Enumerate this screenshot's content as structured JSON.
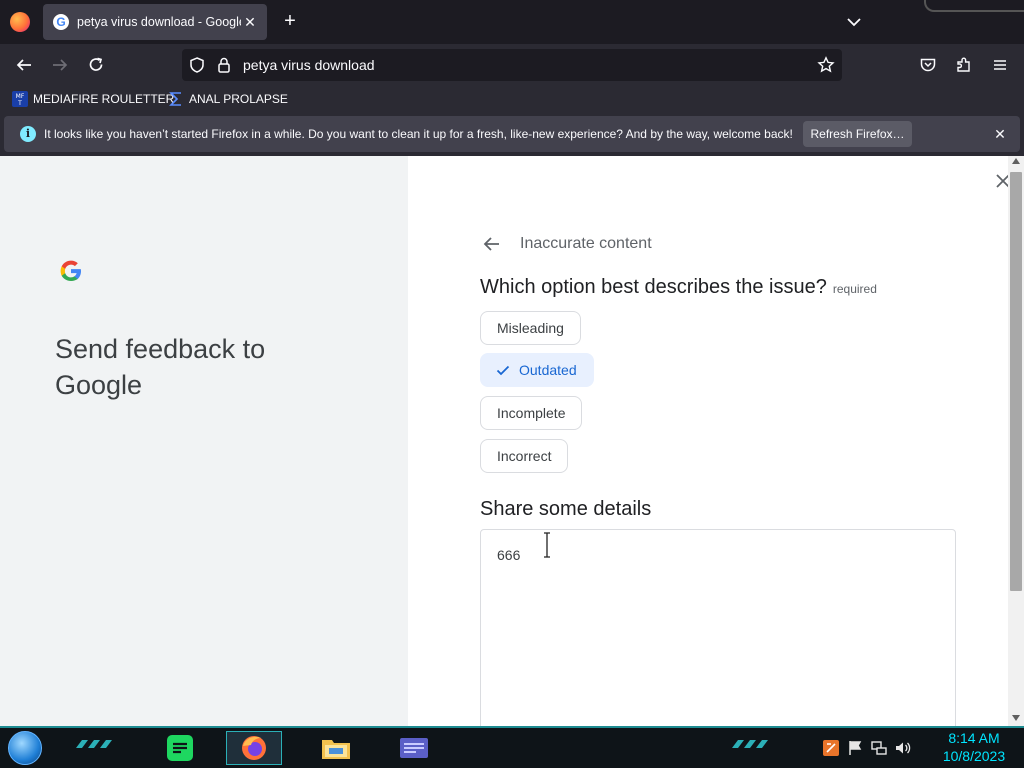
{
  "browser": {
    "tab": {
      "title": "petya virus download - Google Search",
      "close": "✕"
    },
    "new_tab": "+",
    "url": "petya virus download",
    "bookmarks": [
      {
        "label": "MEDIAFIRE ROULETTER"
      },
      {
        "label": "ANAL PROLAPSE"
      }
    ],
    "notification": {
      "info": "i",
      "text": "It looks like you haven’t started Firefox in a while. Do you want to clean it up for a fresh, like-new experience? And by the way, welcome back!",
      "button": "Refresh Firefox…",
      "close": "✕"
    }
  },
  "feedback": {
    "logo": "G",
    "title": "Send feedback to Google",
    "breadcrumb": "Inaccurate content",
    "question": "Which option best describes the issue?",
    "required": "required",
    "options": [
      {
        "label": "Misleading",
        "selected": false
      },
      {
        "label": "Outdated",
        "selected": true
      },
      {
        "label": "Incomplete",
        "selected": false
      },
      {
        "label": "Incorrect",
        "selected": false
      }
    ],
    "details_heading": "Share some details",
    "details_value": "666"
  },
  "taskbar": {
    "apps": [
      "spotify",
      "firefox",
      "file-explorer",
      "window-manager"
    ],
    "time": "8:14 AM",
    "date": "10/8/2023"
  },
  "colors": {
    "selected_chip_bg": "#e8f0fe",
    "selected_chip_text": "#1967d2",
    "notification_bar": "#42414d",
    "taskbar_accent": "#00e5ff"
  }
}
